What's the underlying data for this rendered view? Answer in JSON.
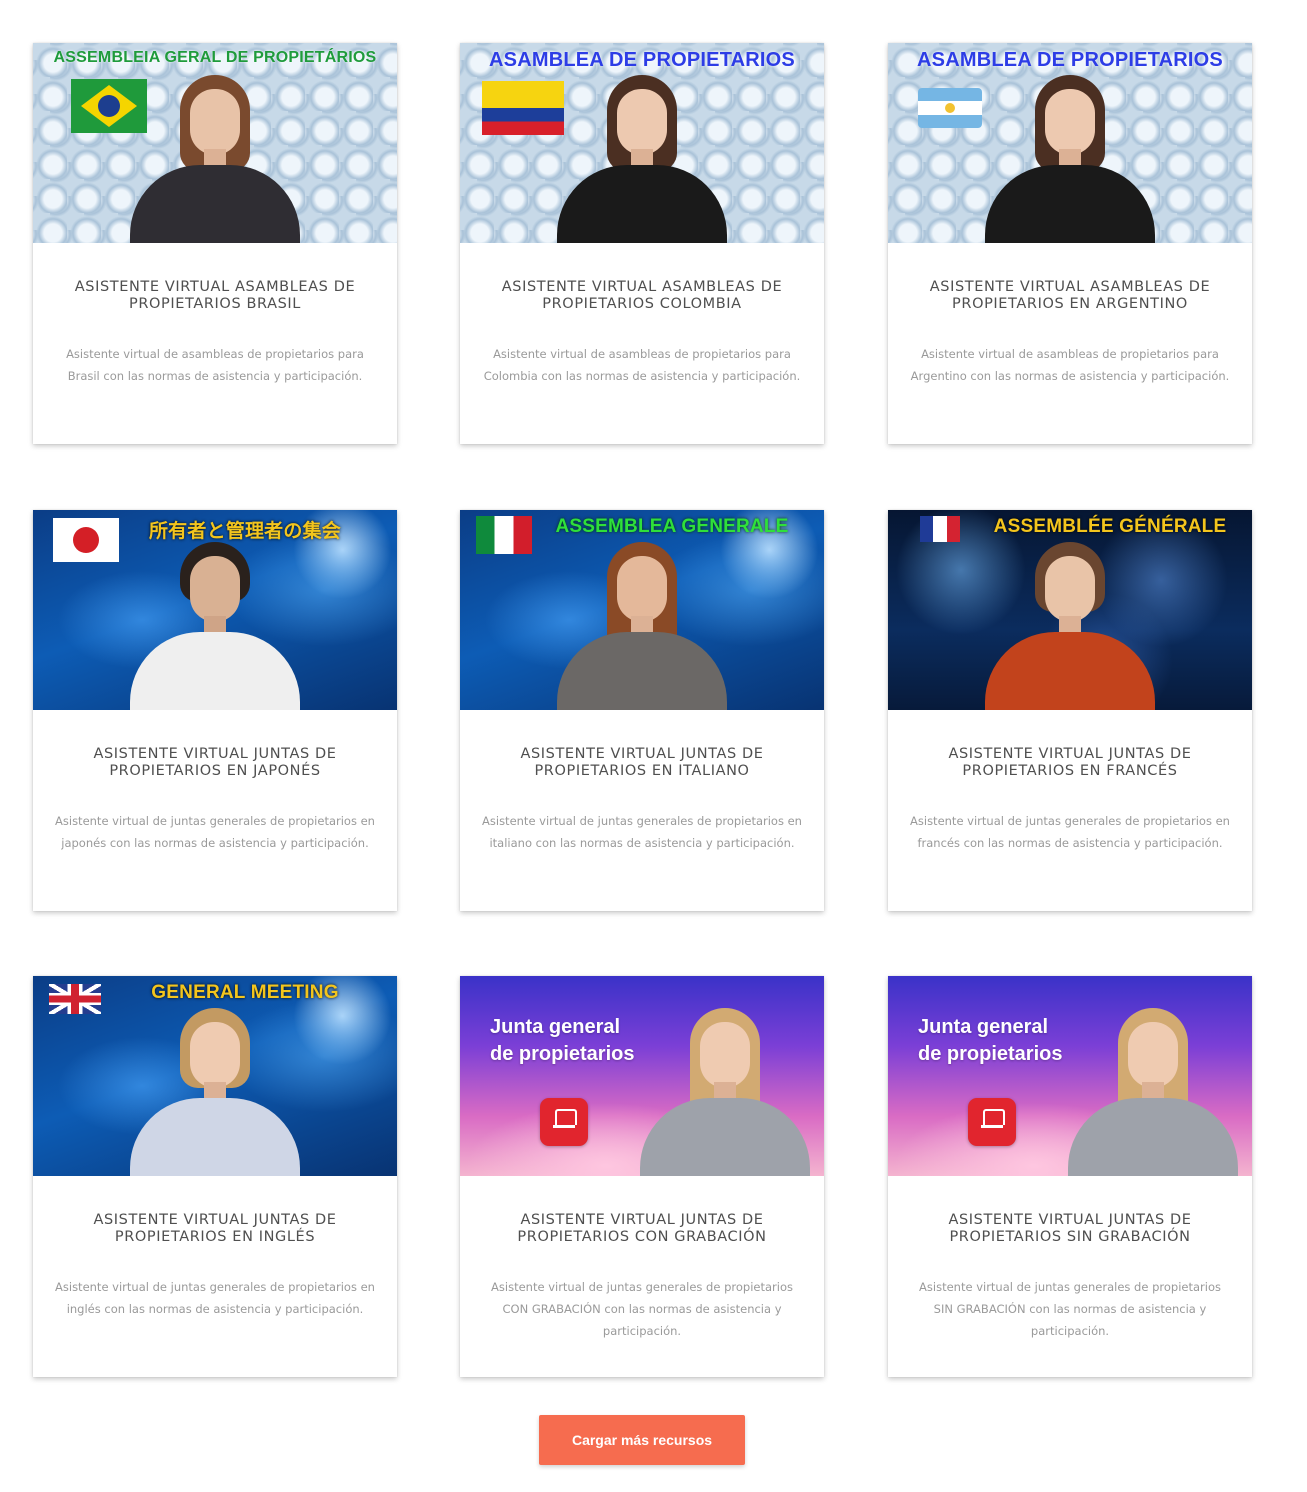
{
  "cards": [
    {
      "banner": "ASSEMBLEIA GERAL DE PROPIETÁRIOS",
      "flag": "brazil-flag",
      "title": "ASISTENTE VIRTUAL ASAMBLEAS DE PROPIETARIOS BRASIL",
      "description": "Asistente virtual de asambleas de propietarios para Brasil con las normas de asistencia y participación."
    },
    {
      "banner": "ASAMBLEA DE PROPIETARIOS",
      "flag": "colombia-flag",
      "title": "ASISTENTE VIRTUAL ASAMBLEAS DE PROPIETARIOS COLOMBIA",
      "description": "Asistente virtual de asambleas de propietarios para Colombia con las normas de asistencia y participación."
    },
    {
      "banner": "ASAMBLEA DE PROPIETARIOS",
      "flag": "argentina-flag",
      "title": "ASISTENTE VIRTUAL ASAMBLEAS DE PROPIETARIOS EN ARGENTINO",
      "description": "Asistente virtual de asambleas de propietarios para Argentino con las normas de asistencia y participación."
    },
    {
      "banner": "所有者と管理者の集会",
      "flag": "japan-flag",
      "title": "ASISTENTE VIRTUAL JUNTAS DE PROPIETARIOS EN JAPONÉS",
      "description": "Asistente virtual de juntas generales de propietarios en japonés con las normas de asistencia y participación."
    },
    {
      "banner": "ASSEMBLEA GENERALE",
      "flag": "italy-flag",
      "title": "ASISTENTE VIRTUAL JUNTAS DE PROPIETARIOS EN ITALIANO",
      "description": "Asistente virtual de juntas generales de propietarios en italiano con las normas de asistencia y participación."
    },
    {
      "banner": "ASSEMBLÉE GÉNÉRALE",
      "flag": "france-flag",
      "title": "ASISTENTE VIRTUAL JUNTAS DE PROPIETARIOS EN FRANCÉS",
      "description": "Asistente virtual de juntas generales de propietarios en francés con las normas de asistencia y participación."
    },
    {
      "banner": "GENERAL MEETING",
      "flag": "uk-flag",
      "title": "ASISTENTE VIRTUAL JUNTAS DE PROPIETARIOS EN INGLÉS",
      "description": "Asistente virtual de juntas generales de propietarios en inglés con las normas de asistencia y participación."
    },
    {
      "overlay_line1": "Junta general",
      "overlay_line2": "de propietarios",
      "logo": "afc-logo-icon",
      "title": "ASISTENTE VIRTUAL JUNTAS DE PROPIETARIOS CON GRABACIÓN",
      "description": "Asistente virtual de juntas generales de propietarios CON GRABACIÓN con las normas de asistencia y participación."
    },
    {
      "overlay_line1": "Junta general",
      "overlay_line2": "de propietarios",
      "logo": "afc-logo-icon",
      "title": "ASISTENTE VIRTUAL JUNTAS DE PROPIETARIOS SIN GRABACIÓN",
      "description": "Asistente virtual de juntas generales de propietarios SIN GRABACIÓN con las normas de asistencia y participación."
    }
  ],
  "load_more_label": "Cargar más recursos",
  "colors": {
    "button": "#f66c4f",
    "title_text": "#4f4f4f",
    "desc_text": "#9a9a9a"
  }
}
